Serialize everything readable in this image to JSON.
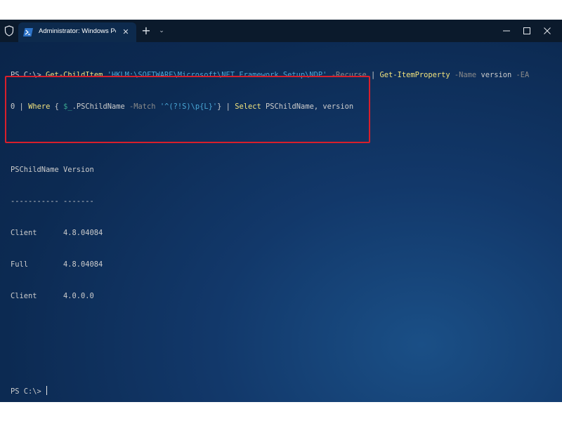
{
  "window": {
    "tab_title": "Administrator: Windows PowerShell",
    "tab_close": "✕",
    "new_tab": "+",
    "tab_dropdown": "⌄",
    "icons": {
      "shield": "shield-icon",
      "powershell": "powershell-icon",
      "minimize": "minimize-icon",
      "maximize": "maximize-icon",
      "close": "close-icon"
    }
  },
  "command": {
    "prompt": "PS C:\\> ",
    "line1": {
      "cmd1": "Get-ChildItem",
      "path": "'HKLM:\\SOFTWARE\\Microsoft\\NET Framework Setup\\NDP'",
      "param1": "-Recurse",
      "pipe1": "|",
      "cmd2": "Get-ItemProperty",
      "param2": "-Name",
      "arg_name": "version",
      "param3": "-EA"
    },
    "line2": {
      "ea_value": "0",
      "pipe2": "|",
      "cmd3": "Where",
      "brace_open": "{",
      "var": "$_",
      "prop": ".PSChildName",
      "param4": "-Match",
      "regex": "'^(?!S)\\p{L}'",
      "brace_close": "}",
      "pipe3": "|",
      "cmd4": "Select",
      "select_args": "PSChildName, version"
    }
  },
  "output": {
    "headers": [
      "PSChildName",
      "Version"
    ],
    "separators": [
      "-----------",
      "-------"
    ],
    "rows": [
      {
        "PSChildName": "Client",
        "Version": "4.8.04084"
      },
      {
        "PSChildName": "Full",
        "Version": "4.8.04084"
      },
      {
        "PSChildName": "Client",
        "Version": "4.0.0.0"
      }
    ]
  },
  "final_prompt": "PS C:\\> ",
  "colors": {
    "highlight_border": "#d81f2b",
    "command": "#f2e37d",
    "string": "#4aa7d6",
    "parameter": "#8a8a8a",
    "variable": "#3aa68f"
  }
}
